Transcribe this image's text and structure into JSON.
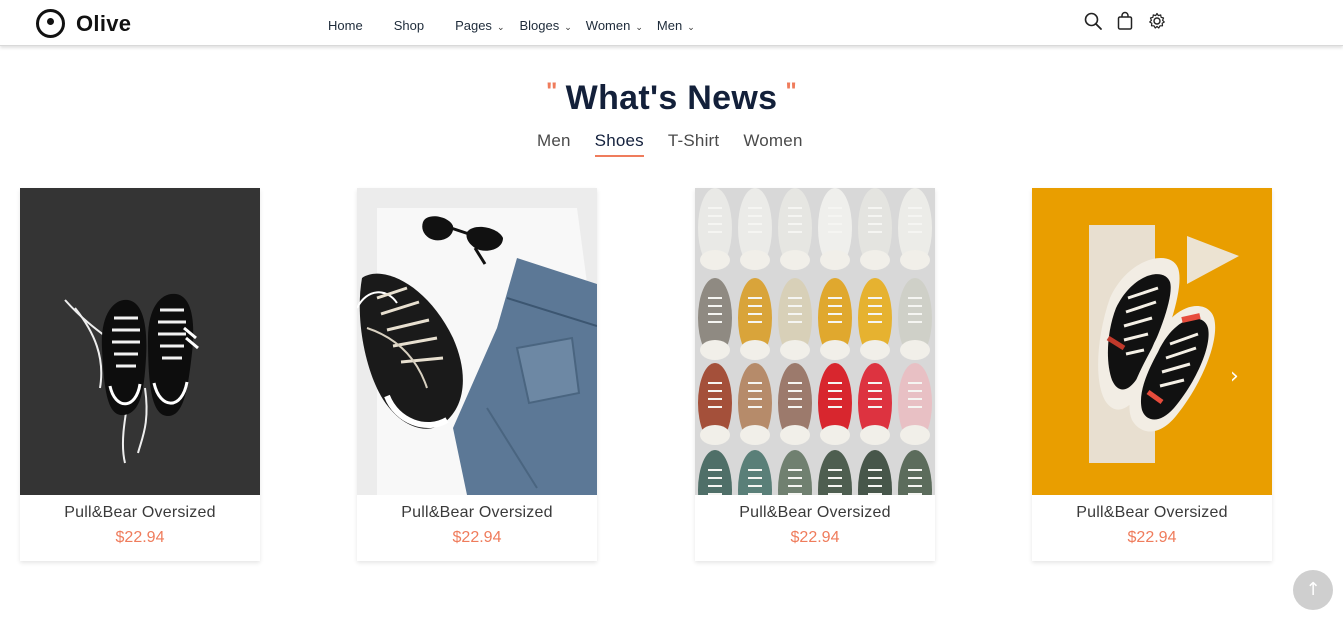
{
  "brand": {
    "name": "Olive"
  },
  "nav": {
    "items": [
      {
        "label": "Home",
        "has_dropdown": false
      },
      {
        "label": "Shop",
        "has_dropdown": false
      },
      {
        "label": "Pages",
        "has_dropdown": true
      },
      {
        "label": "Bloges",
        "has_dropdown": true
      },
      {
        "label": "Women",
        "has_dropdown": true
      },
      {
        "label": "Men",
        "has_dropdown": true
      }
    ],
    "chevron": "⌄"
  },
  "header_icons": [
    "search-icon",
    "shopping-bag-icon",
    "settings-icon"
  ],
  "section": {
    "quote_open": "\"",
    "title": "What's News",
    "quote_close": "\""
  },
  "tabs": [
    {
      "label": "Men",
      "active": false
    },
    {
      "label": "Shoes",
      "active": true
    },
    {
      "label": "T-Shirt",
      "active": false
    },
    {
      "label": "Women",
      "active": false
    }
  ],
  "products": [
    {
      "title": "Pull&Bear Oversized",
      "price": "$22.94",
      "image": "black-sneakers-on-asphalt"
    },
    {
      "title": "Pull&Bear Oversized",
      "price": "$22.94",
      "image": "sneakers-jeans-sunglasses"
    },
    {
      "title": "Pull&Bear Oversized",
      "price": "$22.94",
      "image": "rows-of-colored-shoes"
    },
    {
      "title": "Pull&Bear Oversized",
      "price": "$22.94",
      "image": "sneakers-on-yellow"
    }
  ],
  "carousel": {
    "next_icon": "›"
  },
  "scroll_top": {
    "icon": "↑"
  },
  "colors": {
    "accent": "#ef7c5c",
    "heading": "#13203a",
    "card_yellow": "#e99e00"
  }
}
